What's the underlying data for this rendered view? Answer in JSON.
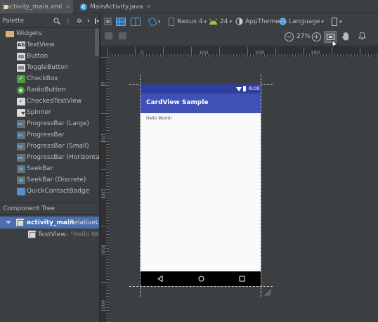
{
  "tabs": [
    {
      "label": "activity_main.xml",
      "active": true
    },
    {
      "label": "MainActivity.java",
      "active": false
    }
  ],
  "palette": {
    "title": "Palette",
    "group": "Widgets",
    "items": [
      {
        "label": "TextView",
        "icon": "textview-icon"
      },
      {
        "label": "Button",
        "icon": "button-icon"
      },
      {
        "label": "ToggleButton",
        "icon": "toggle-button-icon"
      },
      {
        "label": "CheckBox",
        "icon": "checkbox-icon"
      },
      {
        "label": "RadioButton",
        "icon": "radio-button-icon"
      },
      {
        "label": "CheckedTextView",
        "icon": "checked-textview-icon"
      },
      {
        "label": "Spinner",
        "icon": "spinner-icon"
      },
      {
        "label": "ProgressBar (Large)",
        "icon": "progressbar-icon"
      },
      {
        "label": "ProgressBar",
        "icon": "progressbar-icon"
      },
      {
        "label": "ProgressBar (Small)",
        "icon": "progressbar-icon"
      },
      {
        "label": "ProgressBar (Horizontal)",
        "icon": "progressbar-icon"
      },
      {
        "label": "SeekBar",
        "icon": "seekbar-icon"
      },
      {
        "label": "SeekBar (Discrete)",
        "icon": "seekbar-icon"
      },
      {
        "label": "QuickContactBadge",
        "icon": "quick-contact-badge-icon"
      }
    ]
  },
  "component_tree": {
    "title": "Component Tree",
    "root": {
      "label": "activity_main",
      "detail": "(RelativeLay"
    },
    "child": {
      "label": "TextView",
      "detail": "- \"Hello Wor"
    }
  },
  "toolbar": {
    "device": "Nexus 4",
    "api": "24",
    "theme": "AppTheme",
    "language": "Language"
  },
  "zoom": {
    "level": "27%"
  },
  "ruler": {
    "h_ticks": [
      "0",
      "100",
      "200",
      "300"
    ],
    "v_ticks": [
      "0",
      "100",
      "200",
      "300",
      "400"
    ]
  },
  "device_preview": {
    "time": "6:00",
    "app_title": "CardView Sample",
    "body_text": "Hello World!"
  },
  "colors": {
    "ide_background": "#3c3f41",
    "status_bar": "#303f9f",
    "app_bar": "#3f51b5",
    "selection": "#4b6eaf"
  }
}
